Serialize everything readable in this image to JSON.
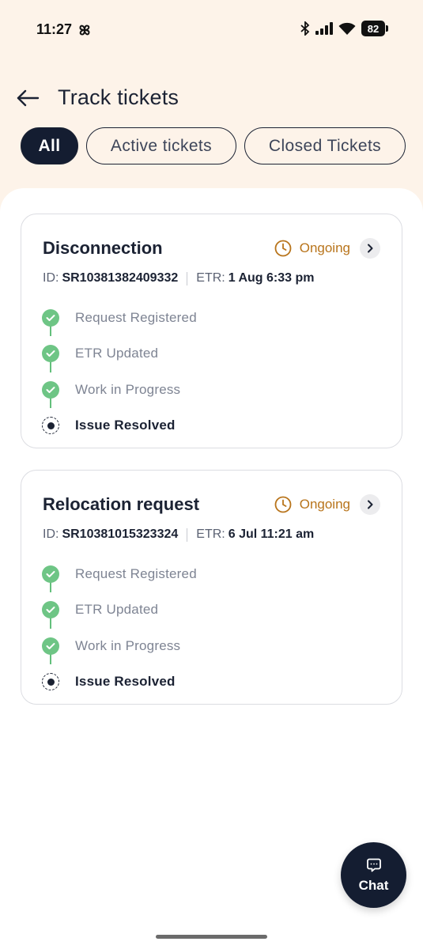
{
  "status_bar": {
    "time": "11:27",
    "battery": "82",
    "icons": [
      "pinwheel-icon",
      "bluetooth-icon",
      "signal-icon",
      "wifi-icon",
      "battery-icon"
    ]
  },
  "header": {
    "title": "Track tickets",
    "back_icon": "arrow-left-icon"
  },
  "tabs": [
    {
      "label": "All",
      "active": true
    },
    {
      "label": "Active tickets",
      "active": false
    },
    {
      "label": "Closed Tickets",
      "active": false
    }
  ],
  "tickets": [
    {
      "title": "Disconnection",
      "status": "Ongoing",
      "id_label": "ID:",
      "id": "SR10381382409332",
      "etr_label": "ETR:",
      "etr": "1 Aug 6:33 pm",
      "steps": [
        {
          "label": "Request Registered",
          "state": "done"
        },
        {
          "label": "ETR Updated",
          "state": "done"
        },
        {
          "label": "Work in Progress",
          "state": "done"
        },
        {
          "label": "Issue Resolved",
          "state": "current"
        }
      ]
    },
    {
      "title": "Relocation request",
      "status": "Ongoing",
      "id_label": "ID:",
      "id": "SR10381015323324",
      "etr_label": "ETR:",
      "etr": "6 Jul 11:21 am",
      "steps": [
        {
          "label": "Request Registered",
          "state": "done"
        },
        {
          "label": "ETR Updated",
          "state": "done"
        },
        {
          "label": "Work in Progress",
          "state": "done"
        },
        {
          "label": "Issue Resolved",
          "state": "current"
        }
      ]
    }
  ],
  "chat": {
    "label": "Chat"
  },
  "colors": {
    "header_bg": "#fdf3e9",
    "primary_dark": "#141d31",
    "status_ongoing": "#b8741b",
    "step_done": "#6ec585"
  }
}
